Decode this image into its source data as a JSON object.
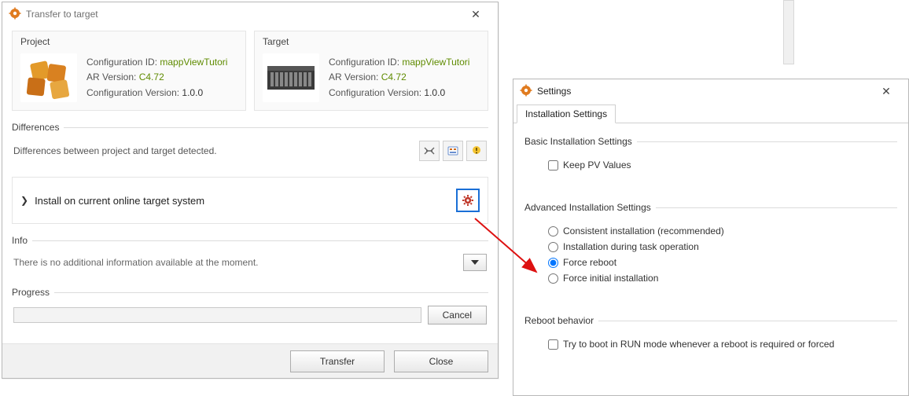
{
  "transfer": {
    "title": "Transfer to target",
    "project": {
      "legend": "Project",
      "config_id_label": "Configuration ID:",
      "config_id": "mappViewTutori",
      "ar_label": "AR Version:",
      "ar": "C4.72",
      "conf_ver_label": "Configuration Version:",
      "conf_ver": "1.0.0"
    },
    "target": {
      "legend": "Target",
      "config_id_label": "Configuration ID:",
      "config_id": "mappViewTutori",
      "ar_label": "AR Version:",
      "ar": "C4.72",
      "conf_ver_label": "Configuration Version:",
      "conf_ver": "1.0.0"
    },
    "differences": {
      "legend": "Differences",
      "text": "Differences between project and target detected."
    },
    "install": {
      "text": "Install on current online target system"
    },
    "info": {
      "legend": "Info",
      "text": "There is no additional information available at the moment."
    },
    "progress": {
      "legend": "Progress",
      "cancel": "Cancel"
    },
    "footer": {
      "transfer": "Transfer",
      "close": "Close"
    }
  },
  "settings": {
    "title": "Settings",
    "tab": "Installation Settings",
    "basic": {
      "legend": "Basic Installation Settings",
      "keep_pv": "Keep PV Values"
    },
    "advanced": {
      "legend": "Advanced Installation Settings",
      "consistent": "Consistent installation (recommended)",
      "during_task": "Installation during task operation",
      "force_reboot": "Force reboot",
      "force_initial": "Force initial installation"
    },
    "reboot": {
      "legend": "Reboot behavior",
      "try_run": "Try to boot in RUN mode whenever a reboot is required or forced"
    }
  }
}
